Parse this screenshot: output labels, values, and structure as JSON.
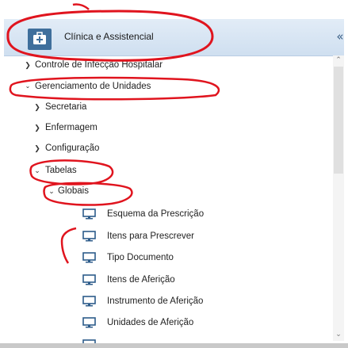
{
  "header": {
    "title": "Clínica e Assistencial",
    "icon": "medical-kit-icon",
    "collapse_glyph": "«"
  },
  "tree": {
    "items": [
      {
        "label": "Controle de Infecção Hospitalar",
        "level": 0,
        "state": "collapsed"
      },
      {
        "label": "Gerenciamento de Unidades",
        "level": 0,
        "state": "expanded"
      },
      {
        "label": "Secretaria",
        "level": 1,
        "state": "collapsed"
      },
      {
        "label": "Enfermagem",
        "level": 1,
        "state": "collapsed"
      },
      {
        "label": "Configuração",
        "level": 1,
        "state": "collapsed"
      },
      {
        "label": "Tabelas",
        "level": 1,
        "state": "expanded"
      },
      {
        "label": "Globais",
        "level": 2,
        "state": "expanded"
      },
      {
        "label": "Esquema da Prescrição",
        "level": 3,
        "state": "leaf"
      },
      {
        "label": "Itens para Prescrever",
        "level": 3,
        "state": "leaf"
      },
      {
        "label": "Tipo Documento",
        "level": 3,
        "state": "leaf"
      },
      {
        "label": "Itens de Aferição",
        "level": 3,
        "state": "leaf"
      },
      {
        "label": "Instrumento de Aferição",
        "level": 3,
        "state": "leaf"
      },
      {
        "label": "Unidades de Aferição",
        "level": 3,
        "state": "leaf"
      },
      {
        "label": "",
        "level": 3,
        "state": "leaf"
      }
    ]
  },
  "colors": {
    "header_bg": "#d6e4f3",
    "accent": "#3f6f9c",
    "annotation_red": "#e0141e"
  }
}
